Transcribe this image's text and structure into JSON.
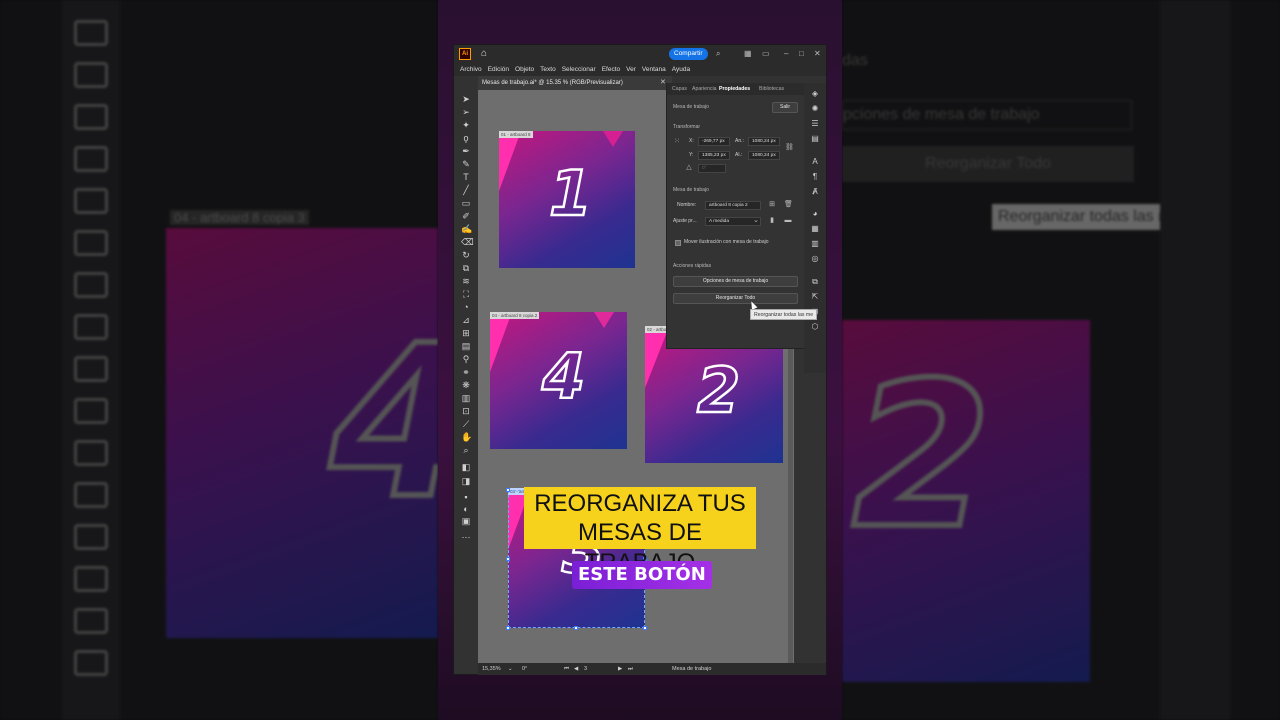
{
  "app": {
    "logo": "Ai",
    "share_label": "Compartir"
  },
  "menu": [
    "Archivo",
    "Edición",
    "Objeto",
    "Texto",
    "Seleccionar",
    "Efecto",
    "Ver",
    "Ventana",
    "Ayuda"
  ],
  "document": {
    "tab_title": "Mesas de trabajo.ai* @ 15.35 % (RGB/Previsualizar)"
  },
  "artboards": [
    {
      "label": "01 - artboard 8",
      "number": "1"
    },
    {
      "label": "04 - artboard 8 copia 2",
      "number": "4"
    },
    {
      "label": "02 - artboard 8 copia",
      "number": "2"
    },
    {
      "label": "03 - artboard 8 copia",
      "number": "3"
    }
  ],
  "panel": {
    "tabs": [
      "Capas",
      "Apariencia",
      "Propiedades",
      "Bibliotecas"
    ],
    "active_tab": "Propiedades",
    "section_title": "Mesa de trabajo",
    "exit_label": "Salir",
    "transform_head": "Transformar",
    "x_label": "X:",
    "x_value": "-269,77 px",
    "y_label": "Y:",
    "y_value": "1385,23 px",
    "w_label": "An.:",
    "w_value": "1080,24 px",
    "h_label": "Al.:",
    "h_value": "1080,24 px",
    "angle_value": "0°",
    "artboard_head": "Mesa de trabajo",
    "name_label": "Nombre:",
    "name_value": "artboard 8 copia 2",
    "preset_label": "Ajuste pr...",
    "preset_value": "A medida",
    "move_art_label": "Mover ilustración con mesa de trabajo",
    "quick_head": "Acciones rápidas",
    "options_button": "Opciones de mesa de trabajo",
    "rearrange_button": "Reorganizar Todo"
  },
  "tooltip": "Reorganizar todas las me",
  "statusbar": {
    "zoom": "15,35%",
    "rotation": "0°",
    "artboard_index": "3",
    "tool_name": "Mesa de trabajo"
  },
  "captions": {
    "line1": "REORGANIZA TUS",
    "line2": "MESAS DE TRABAJO",
    "sub": "ESTE BOTÓN"
  },
  "background": {
    "left_label": "04 - artboard 8 copia 3",
    "right_items": [
      "das",
      "pciones de mesa de trabajo",
      "Reorganizar Todo",
      "Reorganizar todas las me"
    ],
    "left_number": "4",
    "right_number": "2"
  },
  "colors": {
    "accent_blue": "#1473e6",
    "caption_yellow": "#f7d21c",
    "caption_purple": "#a530e6"
  }
}
